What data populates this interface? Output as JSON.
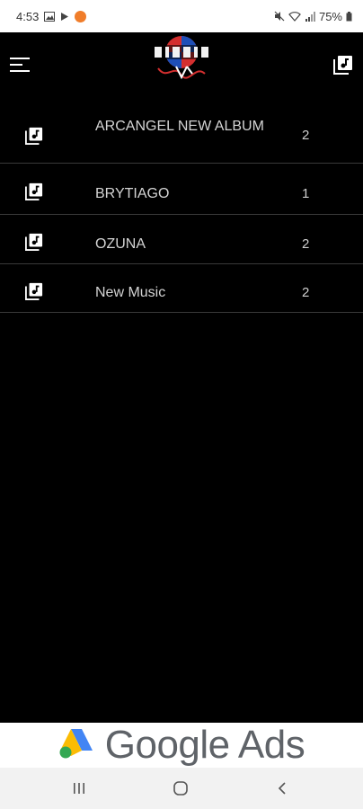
{
  "status_bar": {
    "time": "4:53",
    "battery": "75%",
    "icons": [
      "gallery-icon",
      "play-store-icon",
      "notification-app-icon",
      "mute-icon",
      "wifi-icon",
      "signal-icon",
      "battery-icon"
    ]
  },
  "app_bar": {
    "menu_icon": "hamburger-menu-icon",
    "logo": "brand-logo",
    "action_icon": "playlist-icon"
  },
  "playlists": [
    {
      "title": "ARCANGEL NEW ALBUM",
      "count": "2"
    },
    {
      "title": "BRYTIAGO",
      "count": "1"
    },
    {
      "title": "OZUNA",
      "count": "2"
    },
    {
      "title": "New Music",
      "count": "2"
    }
  ],
  "ad": {
    "text": "Google Ads"
  },
  "nav_bar": {
    "icons": [
      "recent-apps-icon",
      "home-icon",
      "back-icon"
    ]
  },
  "colors": {
    "background": "#000000",
    "divider": "#3a3a3a",
    "text": "#d4d4d4",
    "logo_red": "#d32f2f",
    "logo_blue": "#1e4fb8"
  }
}
